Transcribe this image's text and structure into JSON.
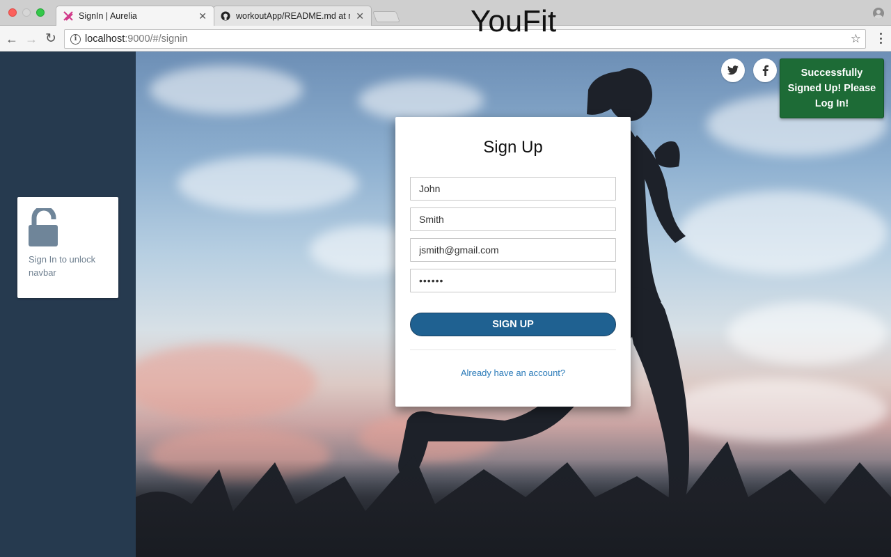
{
  "browser": {
    "tabs": [
      {
        "title": "SignIn | Aurelia",
        "active": true,
        "icon": "aurelia-icon"
      },
      {
        "title": "workoutApp/README.md at m",
        "active": false,
        "icon": "github-icon"
      }
    ],
    "url_host": "localhost",
    "url_path": ":9000/#/signin"
  },
  "brand": "YouFit",
  "social": [
    "twitter-icon",
    "facebook-icon"
  ],
  "toast": {
    "line1": "Successfully",
    "line2": "Signed Up! Please",
    "line3": "Log In!",
    "color": "#1d6b36"
  },
  "sidebar": {
    "lock_text": "Sign In to unlock navbar",
    "color": "#263a4f"
  },
  "form": {
    "title": "Sign Up",
    "first_name": "John",
    "last_name": "Smith",
    "email": "jsmith@gmail.com",
    "password": "••••••",
    "submit_label": "SIGN UP",
    "login_link": "Already have an account?",
    "button_color": "#1f6191"
  }
}
